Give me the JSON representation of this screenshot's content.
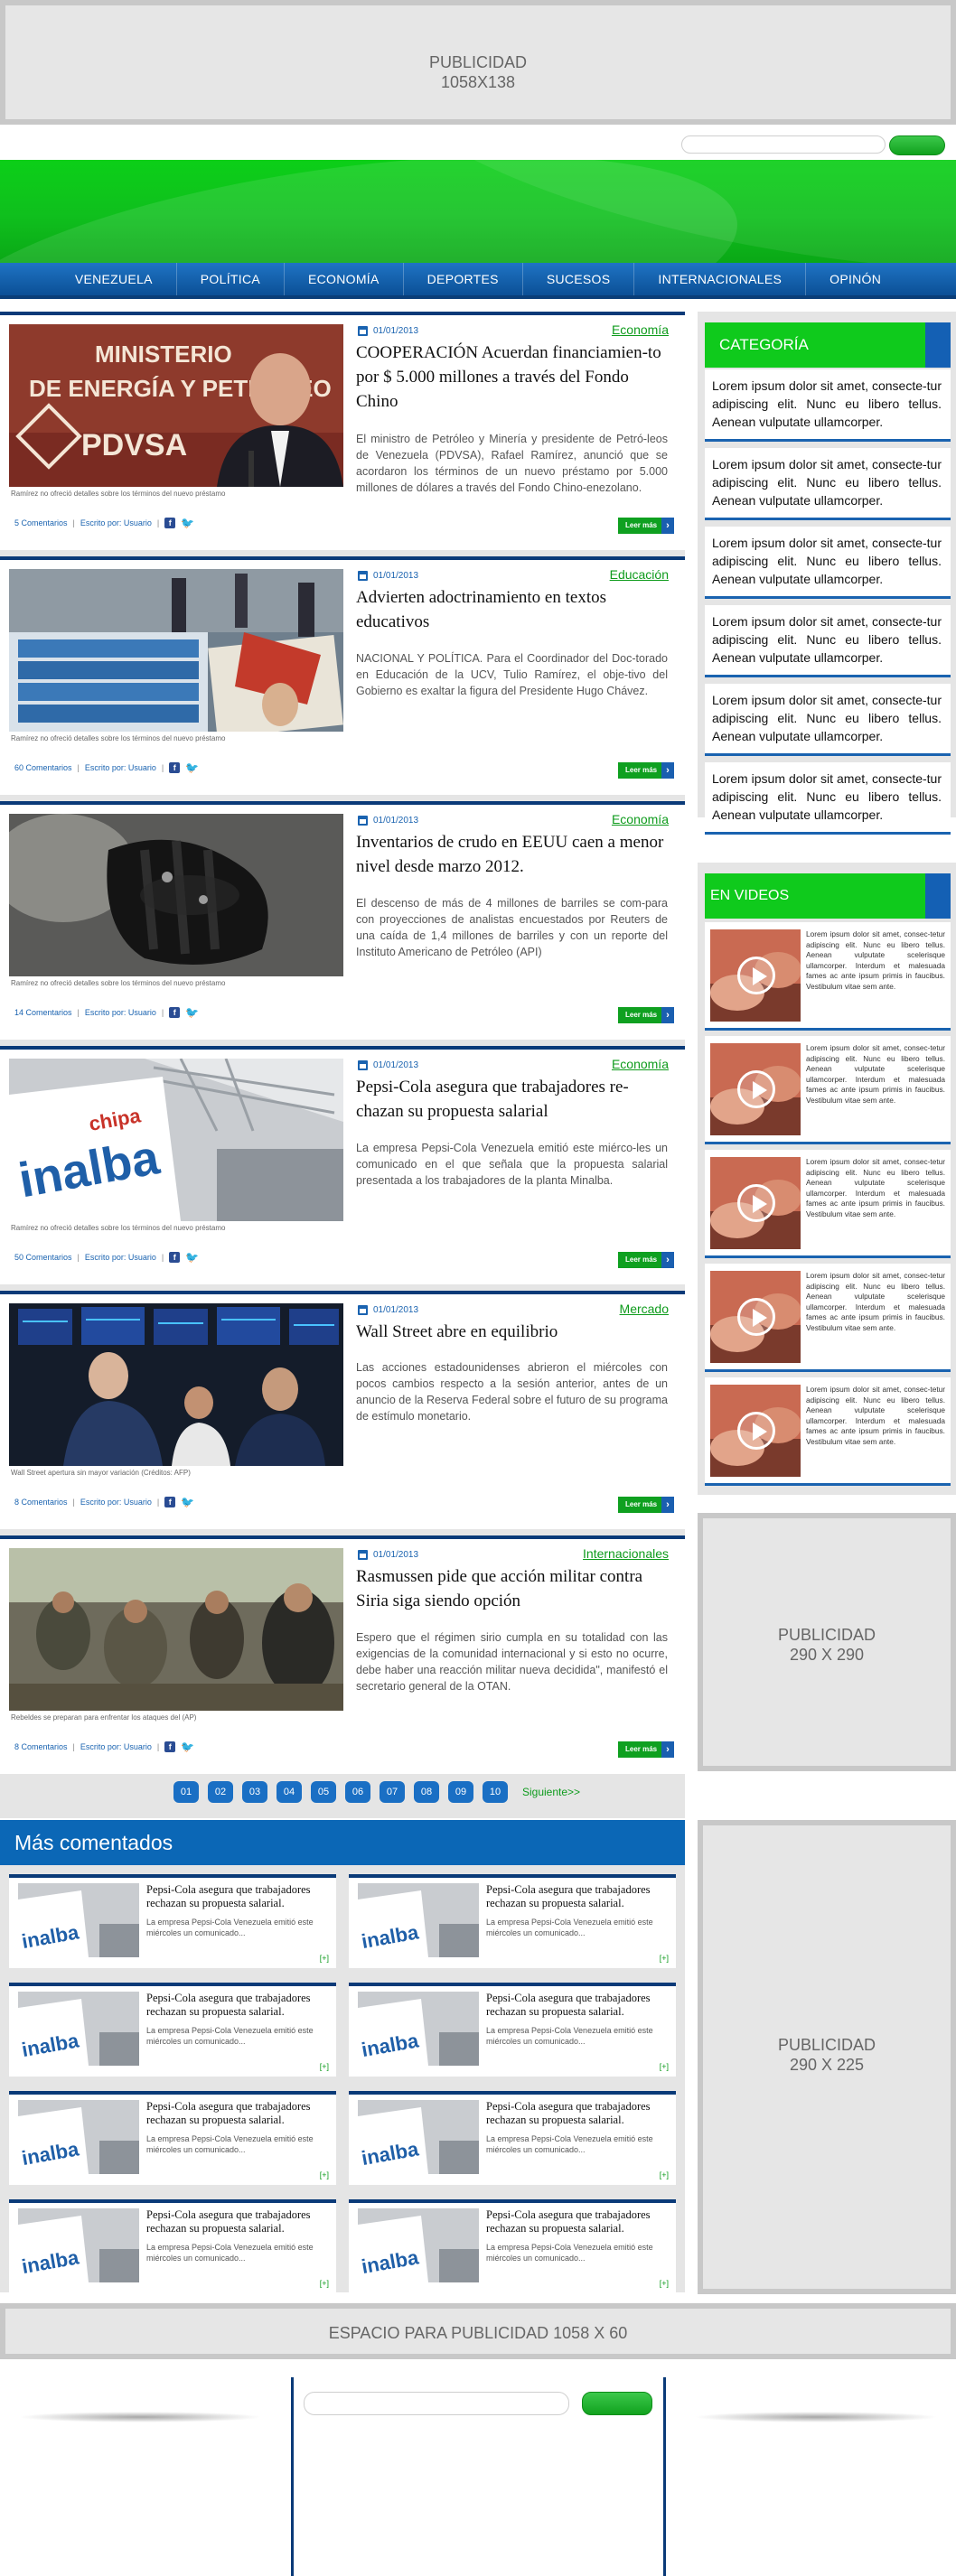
{
  "ads": {
    "top": {
      "line1": "PUBLICIDAD",
      "line2": "1058X138"
    },
    "side1": {
      "line1": "PUBLICIDAD",
      "line2": "290 X 290"
    },
    "side2": {
      "line1": "PUBLICIDAD",
      "line2": "290 X 225"
    },
    "bottom": {
      "line1": "ESPACIO PARA PUBLICIDAD 1058 X 60"
    }
  },
  "nav": [
    "VENEZUELA",
    "POLÍTICA",
    "ECONOMÍA",
    "DEPORTES",
    "SUCESOS",
    "INTERNACIONALES",
    "OPINÓN"
  ],
  "articles": [
    {
      "date": "01/01/2013",
      "category": "Economía",
      "title": "COOPERACIÓN Acuerdan financiamien-to por $ 5.000 millones a través del Fondo Chino",
      "text": "El ministro de Petróleo y Minería y presidente de Petró-leos de Venezuela (PDVSA), Rafael Ramírez, anunció que se acordaron los términos de un nuevo préstamo por 5.000 millones de dólares a través del Fondo Chino-enezolano.",
      "caption": "Ramírez no ofreció detalles sobre los términos del nuevo préstamo",
      "comments": "5 Comentarios",
      "author": "Escrito por: Usuario",
      "read_more": "Leer más",
      "photo_theme": "pdvsa"
    },
    {
      "date": "01/01/2013",
      "category": "Educación",
      "title": "Advierten adoctrinamiento en textos educativos",
      "text": "NACIONAL Y POLÍTICA. Para el Coordinador del Doc-torado en Educación de la UCV, Tulio Ramírez, el obje-tivo del Gobierno es exaltar la figura del Presidente Hugo Chávez.",
      "caption": "Ramírez no ofreció detalles sobre los términos del nuevo préstamo",
      "comments": "60 Comentarios",
      "author": "Escrito por: Usuario",
      "read_more": "Leer más",
      "photo_theme": "books"
    },
    {
      "date": "01/01/2013",
      "category": "Economía",
      "title": "Inventarios de crudo en EEUU caen a menor nivel desde marzo 2012.",
      "text": "El descenso de más de 4 millones de barriles se com-para con proyecciones de analistas encuestados por Reuters de una caída de 1,4 millones de barriles y con un reporte del Instituto Americano de Petróleo (API)",
      "caption": "Ramírez no ofreció detalles sobre los términos del nuevo préstamo",
      "comments": "14 Comentarios",
      "author": "Escrito por: Usuario",
      "read_more": "Leer más",
      "photo_theme": "oil"
    },
    {
      "date": "01/01/2013",
      "category": "Economía",
      "title": "Pepsi-Cola asegura que trabajadores re-chazan su propuesta salarial",
      "text": "La empresa Pepsi-Cola Venezuela emitió este miérco-les un comunicado en el que señala que la propuesta salarial presentada a los trabajadores de la planta Minalba.",
      "caption": "Ramírez no ofreció detalles sobre los términos del nuevo préstamo",
      "comments": "50 Comentarios",
      "author": "Escrito por: Usuario",
      "read_more": "Leer más",
      "photo_theme": "minalba"
    },
    {
      "date": "01/01/2013",
      "category": "Mercado",
      "title": "Wall Street abre en equilibrio",
      "text": "Las acciones estadounidenses abrieron el miércoles con pocos cambios respecto a la sesión anterior, antes de un anuncio de la Reserva Federal sobre el futuro de su programa de estímulo monetario.",
      "caption": "Wall Street apertura sin mayor variación (Créditos: AFP)",
      "comments": "8 Comentarios",
      "author": "Escrito por: Usuario",
      "read_more": "Leer más",
      "photo_theme": "wallstreet"
    },
    {
      "date": "01/01/2013",
      "category": "Internacionales",
      "title": "Rasmussen pide que acción militar contra Siria siga siendo opción",
      "text": "Espero que el régimen sirio cumpla en su totalidad con las exigencias de la comunidad internacional y si esto no ocurre, debe haber una reacción militar nueva decidida\", manifestó el secretario general de la OTAN.",
      "caption": "Rebeldes se preparan para enfrentar los ataques del (AP)",
      "comments": "8 Comentarios",
      "author": "Escrito por: Usuario",
      "read_more": "Leer más",
      "photo_theme": "syria"
    }
  ],
  "pagination": {
    "pages": [
      "01",
      "02",
      "03",
      "04",
      "05",
      "06",
      "07",
      "08",
      "09",
      "10"
    ],
    "next": "Siguiente>>"
  },
  "sidebar": {
    "category_title": "CATEGORÍA",
    "category_items": [
      "Lorem ipsum dolor sit amet, consecte-tur adipiscing elit. Nunc eu libero tellus. Aenean vulputate ullamcorper.",
      "Lorem ipsum dolor sit amet, consecte-tur adipiscing elit. Nunc eu libero tellus. Aenean vulputate ullamcorper.",
      "Lorem ipsum dolor sit amet, consecte-tur adipiscing elit. Nunc eu libero tellus. Aenean vulputate ullamcorper.",
      "Lorem ipsum dolor sit amet, consecte-tur adipiscing elit. Nunc eu libero tellus. Aenean vulputate ullamcorper.",
      "Lorem ipsum dolor sit amet, consecte-tur adipiscing elit. Nunc eu libero tellus. Aenean vulputate ullamcorper.",
      "Lorem ipsum dolor sit amet, consecte-tur adipiscing elit. Nunc eu libero tellus. Aenean vulputate ullamcorper."
    ],
    "videos_title": "EN VIDEOS",
    "video_items": [
      "Lorem ipsum dolor sit amet, consec-tetur adipiscing elit. Nunc eu libero tellus. Aenean vulputate scelerisque ullamcorper. Interdum et malesuada fames ac ante ipsum primis in faucibus. Vestibulum vitae sem ante.",
      "Lorem ipsum dolor sit amet, consec-tetur adipiscing elit. Nunc eu libero tellus. Aenean vulputate scelerisque ullamcorper. Interdum et malesuada fames ac ante ipsum primis in faucibus. Vestibulum vitae sem ante.",
      "Lorem ipsum dolor sit amet, consec-tetur adipiscing elit. Nunc eu libero tellus. Aenean vulputate scelerisque ullamcorper. Interdum et malesuada fames ac ante ipsum primis in faucibus. Vestibulum vitae sem ante.",
      "Lorem ipsum dolor sit amet, consec-tetur adipiscing elit. Nunc eu libero tellus. Aenean vulputate scelerisque ullamcorper. Interdum et malesuada fames ac ante ipsum primis in faucibus. Vestibulum vitae sem ante.",
      "Lorem ipsum dolor sit amet, consec-tetur adipiscing elit. Nunc eu libero tellus. Aenean vulputate scelerisque ullamcorper. Interdum et malesuada fames ac ante ipsum primis in faucibus. Vestibulum vitae sem ante."
    ]
  },
  "mas_comentados": {
    "title": "Más comentados",
    "items": [
      {
        "title": "Pepsi-Cola asegura que trabajadores rechazan su propuesta salarial.",
        "text": "La empresa Pepsi-Cola Venezuela emitió este miércoles un comunicado...",
        "more": "[+]"
      },
      {
        "title": "Pepsi-Cola asegura que trabajadores rechazan su propuesta salarial.",
        "text": "La empresa Pepsi-Cola Venezuela emitió este miércoles un comunicado...",
        "more": "[+]"
      },
      {
        "title": "Pepsi-Cola asegura que trabajadores rechazan su propuesta salarial.",
        "text": "La empresa Pepsi-Cola Venezuela emitió este miércoles un comunicado...",
        "more": "[+]"
      },
      {
        "title": "Pepsi-Cola asegura que trabajadores rechazan su propuesta salarial.",
        "text": "La empresa Pepsi-Cola Venezuela emitió este miércoles un comunicado...",
        "more": "[+]"
      },
      {
        "title": "Pepsi-Cola asegura que trabajadores rechazan su propuesta salarial.",
        "text": "La empresa Pepsi-Cola Venezuela emitió este miércoles un comunicado...",
        "more": "[+]"
      },
      {
        "title": "Pepsi-Cola asegura que trabajadores rechazan su propuesta salarial.",
        "text": "La empresa Pepsi-Cola Venezuela emitió este miércoles un comunicado...",
        "more": "[+]"
      },
      {
        "title": "Pepsi-Cola asegura que trabajadores rechazan su propuesta salarial.",
        "text": "La empresa Pepsi-Cola Venezuela emitió este miércoles un comunicado...",
        "more": "[+]"
      },
      {
        "title": "Pepsi-Cola asegura que trabajadores rechazan su propuesta salarial.",
        "text": "La empresa Pepsi-Cola Venezuela emitió este miércoles un comunicado...",
        "more": "[+]"
      }
    ]
  },
  "colors": {
    "brand_green": "#0fca1c",
    "brand_blue": "#0b67b6",
    "nav_blue": "#1460b4"
  },
  "icons": {
    "calendar": "calendar-icon",
    "facebook": "facebook-icon",
    "twitter": "twitter-icon",
    "play": "play-icon",
    "chevron": "chevron-right-icon"
  }
}
